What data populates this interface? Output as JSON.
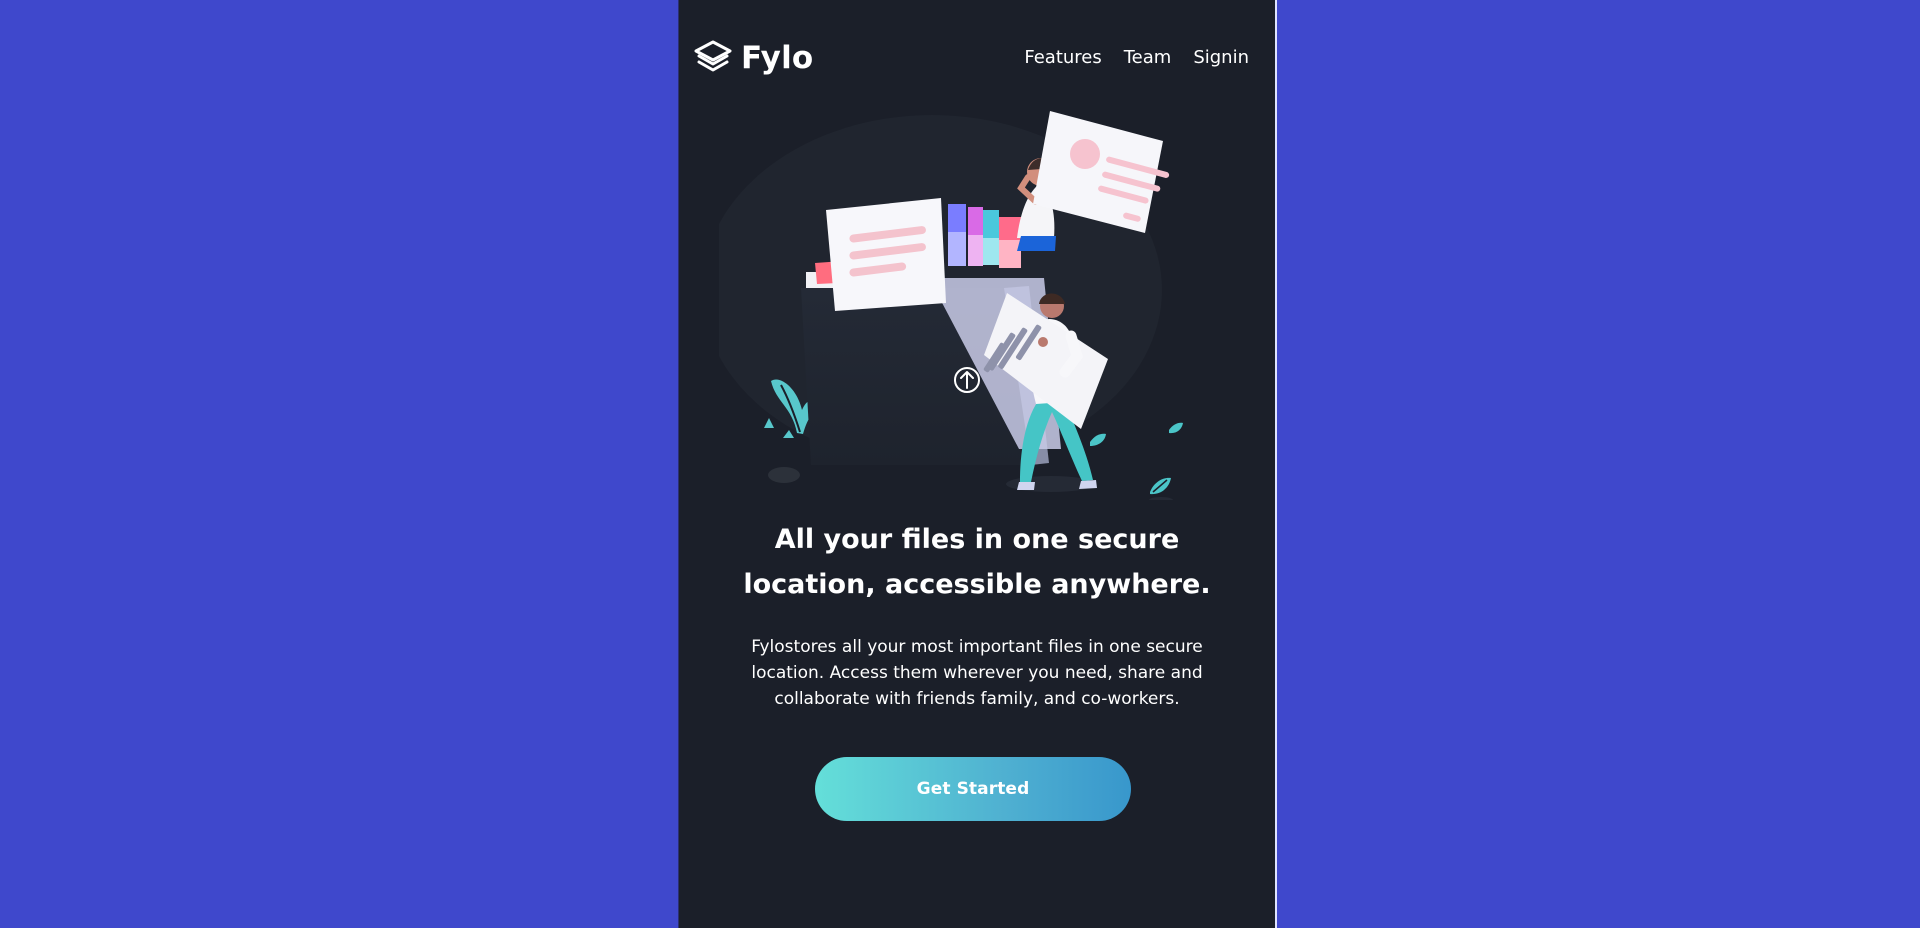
{
  "brand": {
    "name": "Fylo",
    "logo_icon": "layers-icon"
  },
  "nav": {
    "items": [
      {
        "label": "Features"
      },
      {
        "label": "Team"
      },
      {
        "label": "Signin"
      }
    ]
  },
  "hero": {
    "headline_line1": "All your files in one secure",
    "headline_line2": "location, accessible anywhere.",
    "description_line1": "Fylostores all your most important files in one secure",
    "description_line2": "location. Access them wherever you need, share and",
    "description_line3": "collaborate with friends family, and co-workers.",
    "cta_label": "Get Started",
    "upload_icon": "upload-arrow-icon"
  },
  "colors": {
    "page_background": "#3f48cc",
    "card_background": "#1b1f29",
    "cta_gradient_start": "#64dfd9",
    "cta_gradient_end": "#3897cc",
    "text": "#ffffff"
  }
}
